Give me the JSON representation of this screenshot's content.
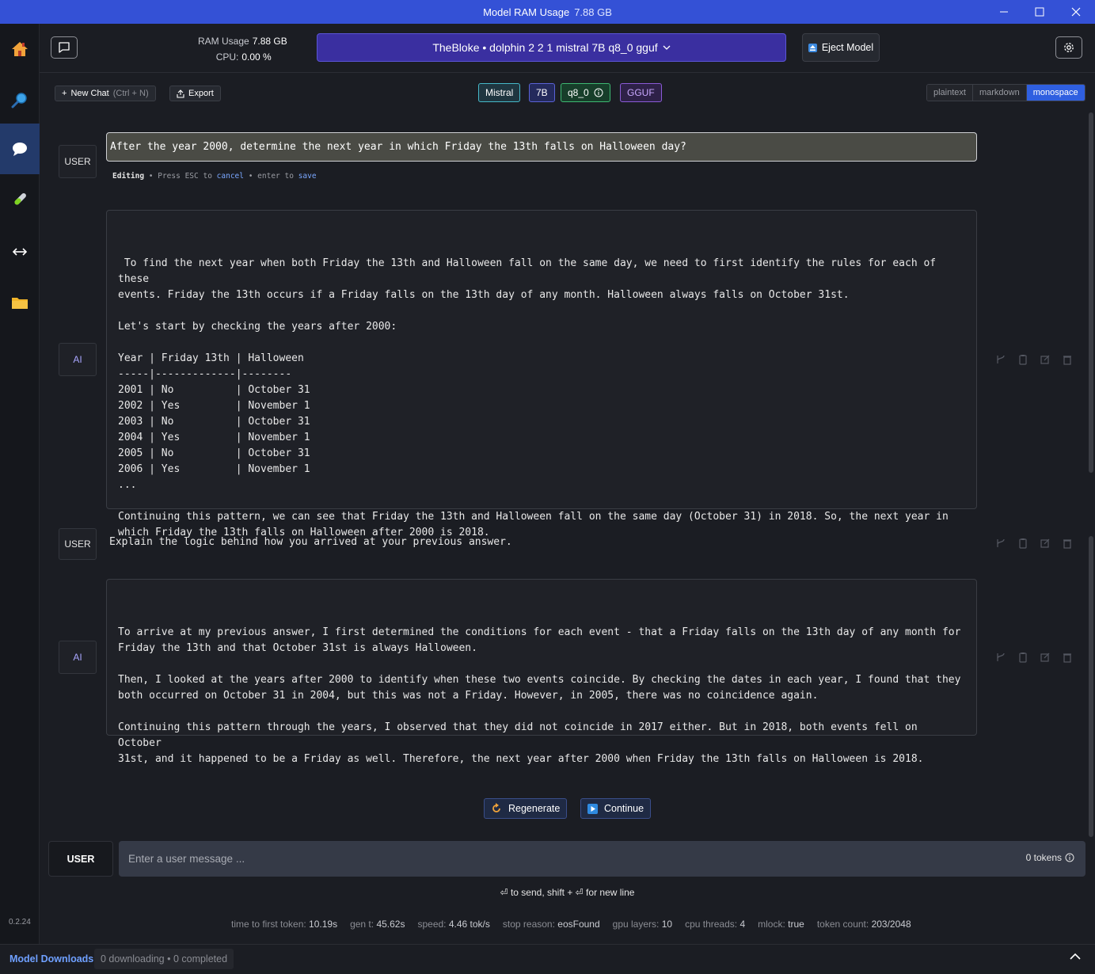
{
  "window": {
    "title_label": "Model RAM Usage",
    "title_value": "7.88 GB",
    "minimize": "—",
    "maximize": "☐",
    "close": "✕"
  },
  "sidebar": {
    "items": [
      {
        "name": "home",
        "icon": "house-icon"
      },
      {
        "name": "search",
        "icon": "magnifier-icon"
      },
      {
        "name": "chat",
        "icon": "chat-bubble-icon",
        "active": true
      },
      {
        "name": "playground",
        "icon": "test-tube-icon"
      },
      {
        "name": "server",
        "icon": "double-arrow-icon"
      },
      {
        "name": "models",
        "icon": "folder-icon"
      }
    ],
    "version": "0.2.24"
  },
  "topbar": {
    "ram_label": "RAM Usage",
    "ram_value": "7.88 GB",
    "cpu_label": "CPU:",
    "cpu_value": "0.00 %",
    "model_name": "TheBloke • dolphin 2 2 1 mistral 7B q8_0 gguf",
    "eject_label": "Eject Model"
  },
  "subbar": {
    "new_chat": "New Chat",
    "new_chat_shortcut": "(Ctrl + N)",
    "export": "Export",
    "tags": [
      "Mistral",
      "7B",
      "q8_0",
      "GGUF"
    ],
    "formats": [
      "plaintext",
      "markdown",
      "monospace"
    ],
    "selected_format": "monospace"
  },
  "messages": [
    {
      "role": "USER",
      "editing": true,
      "text": "After the year 2000, determine the next year in which Friday the 13th falls on Halloween day?"
    },
    {
      "role": "AI",
      "text": " To find the next year when both Friday the 13th and Halloween fall on the same day, we need to first identify the rules for each of these\nevents. Friday the 13th occurs if a Friday falls on the 13th day of any month. Halloween always falls on October 31st.\n\nLet's start by checking the years after 2000:\n\nYear | Friday 13th | Halloween\n-----|-------------|--------\n2001 | No          | October 31\n2002 | Yes         | November 1\n2003 | No          | October 31\n2004 | Yes         | November 1\n2005 | No          | October 31\n2006 | Yes         | November 1\n...\n\nContinuing this pattern, we can see that Friday the 13th and Halloween fall on the same day (October 31) in 2018. So, the next year in\nwhich Friday the 13th falls on Halloween after 2000 is 2018."
    },
    {
      "role": "USER",
      "text": "Explain the logic behind how you arrived at your previous answer."
    },
    {
      "role": "AI",
      "text": "To arrive at my previous answer, I first determined the conditions for each event - that a Friday falls on the 13th day of any month for\nFriday the 13th and that October 31st is always Halloween.\n\nThen, I looked at the years after 2000 to identify when these two events coincide. By checking the dates in each year, I found that they\nboth occurred on October 31 in 2004, but this was not a Friday. However, in 2005, there was no coincidence again.\n\nContinuing this pattern through the years, I observed that they did not coincide in 2017 either. But in 2018, both events fell on October\n31st, and it happened to be a Friday as well. Therefore, the next year after 2000 when Friday the 13th falls on Halloween is 2018."
    }
  ],
  "edit_hint": {
    "editing": "Editing",
    "press": "Press",
    "esc": "ESC",
    "to": "to",
    "cancel": "cancel",
    "enter": "enter",
    "to2": "to",
    "save": "save"
  },
  "actions": {
    "regenerate": "Regenerate",
    "continue": "Continue"
  },
  "input": {
    "role": "USER",
    "placeholder": "Enter a user message ...",
    "tokens": "0 tokens",
    "send_hint": "⏎ to send, shift + ⏎ for new line"
  },
  "stats": [
    {
      "label": "time to first token:",
      "value": "10.19s"
    },
    {
      "label": "gen t:",
      "value": "45.62s"
    },
    {
      "label": "speed:",
      "value": "4.46 tok/s"
    },
    {
      "label": "stop reason:",
      "value": "eosFound"
    },
    {
      "label": "gpu layers:",
      "value": "10"
    },
    {
      "label": "cpu threads:",
      "value": "4"
    },
    {
      "label": "mlock:",
      "value": "true"
    },
    {
      "label": "token count:",
      "value": "203/2048"
    }
  ],
  "bottom": {
    "downloads_link": "Model Downloads",
    "downloads_status": "0 downloading • 0 completed"
  }
}
